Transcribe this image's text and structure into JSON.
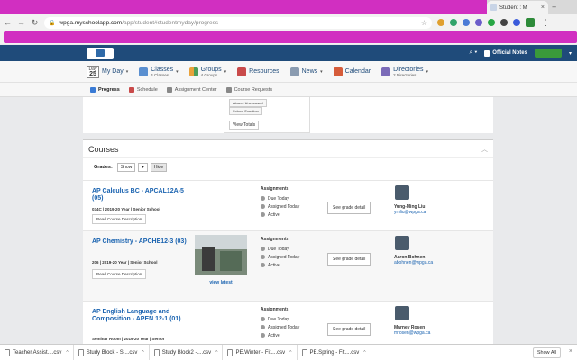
{
  "browser": {
    "tab_title": "Student : M",
    "url_host": "wpga.myschoolapp.com",
    "url_path": "/app/student#studentmyday/progress"
  },
  "header": {
    "official_notes": "Official Notes"
  },
  "nav": {
    "calendar_month": "Day",
    "calendar_day": "25",
    "my_day": "My Day",
    "classes": "Classes",
    "classes_sub": "4 Classes",
    "groups": "Groups",
    "groups_sub": "4 Groups",
    "resources": "Resources",
    "news": "News",
    "calendar": "Calendar",
    "directories": "Directories",
    "directories_sub": "2 Directories"
  },
  "subnav": {
    "progress": "Progress",
    "schedule": "Schedule",
    "assignment_center": "Assignment Center",
    "course_requests": "Course Requests"
  },
  "attendance": {
    "absent_unexcused": "Absent Unexcused",
    "school_function": "School Function",
    "view_totals": "View Totals"
  },
  "courses": {
    "title": "Courses",
    "grades_label": "Grades:",
    "show": "Show",
    "hide": "Hide",
    "items": [
      {
        "name": "AP Calculus BC - APCAL12A-5 (05)",
        "meta": "034C | 2019-20 Year | Senior School",
        "read_desc": "Read Course Description",
        "assign_header": "Assignments",
        "due_today": "Due Today",
        "assigned_today": "Assigned Today",
        "active": "Active",
        "grade_detail": "See grade detail",
        "teacher_name": "Yung-Ming Liu",
        "teacher_email": "ymliu@wpga.ca"
      },
      {
        "name": "AP Chemistry - APCHE12-3 (03)",
        "meta": "206 | 2019-20 Year | Senior School",
        "read_desc": "Read Course Description",
        "view_latest": "view latest",
        "assign_header": "Assignments",
        "due_today": "Due Today",
        "assigned_today": "Assigned Today",
        "active": "Active",
        "grade_detail": "See grade detail",
        "teacher_name": "Aaron Bohnen",
        "teacher_email": "abohnen@wpga.ca"
      },
      {
        "name": "AP English Language and Composition - APEN 12-1 (01)",
        "meta": "Seminar Room | 2019-20 Year | Senior",
        "assign_header": "Assignments",
        "due_today": "Due Today",
        "assigned_today": "Assigned Today",
        "active": "Active",
        "grade_detail": "See grade detail",
        "teacher_name": "Marney Rosen",
        "teacher_email": "mrosen@wpga.ca"
      }
    ]
  },
  "downloads": {
    "items": [
      "Teacher Assist....csv",
      "Study Block - S....csv",
      "Study Block2 -....csv",
      "PE.Winter - Fit....csv",
      "PE.Spring - Fit....csv"
    ],
    "show_all": "Show All"
  },
  "colors": {
    "header_bg": "#1f4b7a",
    "link": "#1a63b0",
    "redaction": "#d12fc1"
  }
}
